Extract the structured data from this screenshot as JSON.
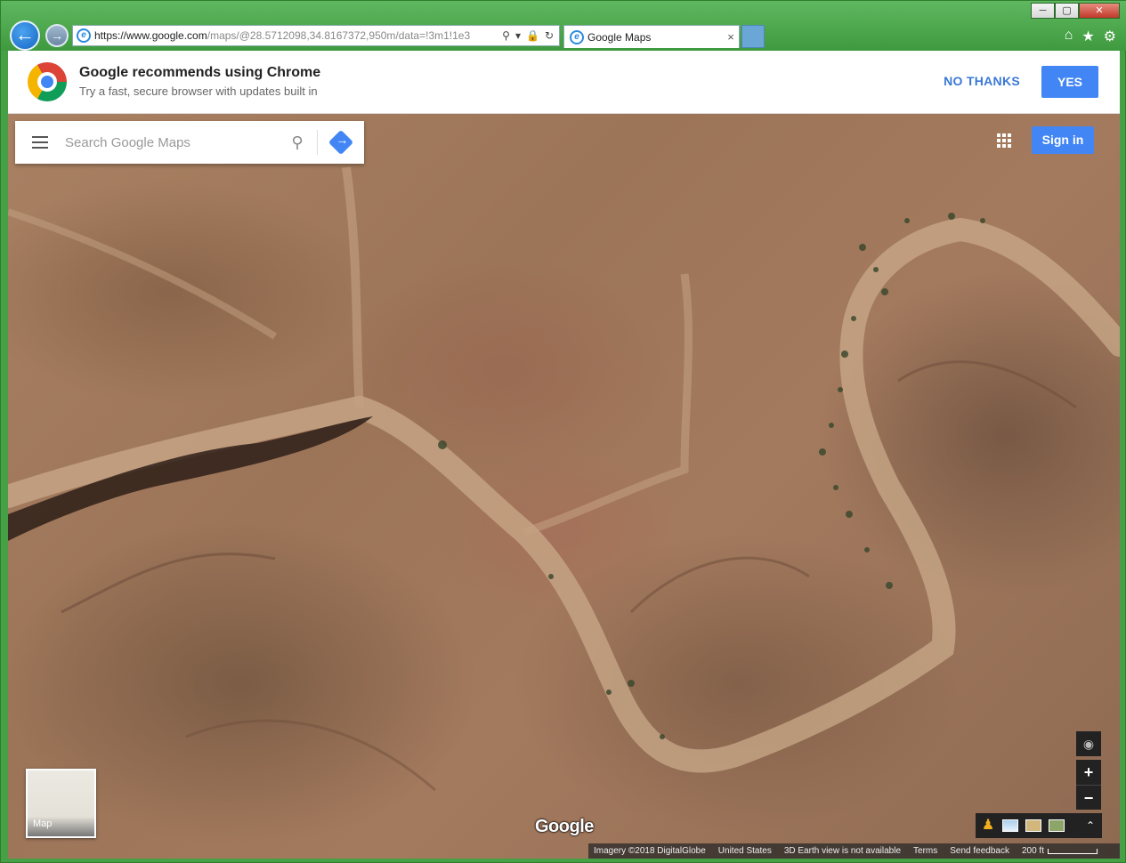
{
  "browser": {
    "url_host": "https://www.google.com",
    "url_path": "/maps/@28.5712098,34.8167372,950m/data=!3m1!1e3",
    "tab_title": "Google Maps",
    "tab_close": "×",
    "back": "←",
    "forward": "→",
    "window_buttons": [
      "─",
      "▢",
      "✕"
    ],
    "tools": [
      "⌂",
      "★",
      "⚙"
    ],
    "address_icons": [
      "⚲",
      "▾",
      "🔒",
      "↻"
    ],
    "icons": {
      "favicon": "internet-explorer-icon",
      "accent": "#46a046"
    }
  },
  "banner": {
    "title": "Google recommends using Chrome",
    "subtitle": "Try a fast, secure browser with updates built in",
    "no_thanks": "NO THANKS",
    "yes": "YES"
  },
  "maps": {
    "search_placeholder": "Search Google Maps",
    "search_glyph": "⚲",
    "sign_in": "Sign in",
    "layer_label": "Map",
    "logo": "Google",
    "zoom_in": "+",
    "zoom_out": "−",
    "location_glyph": "◉",
    "pegman_glyph": "♟",
    "expand_glyph": "⌃",
    "footer": {
      "imagery": "Imagery ©2018 DigitalGlobe",
      "country": "United States",
      "earth": "3D Earth view is not available",
      "terms": "Terms",
      "feedback": "Send feedback",
      "scale": "200 ft"
    },
    "colors": {
      "accent": "#4285f4",
      "terrain": "#a47a5e"
    }
  }
}
